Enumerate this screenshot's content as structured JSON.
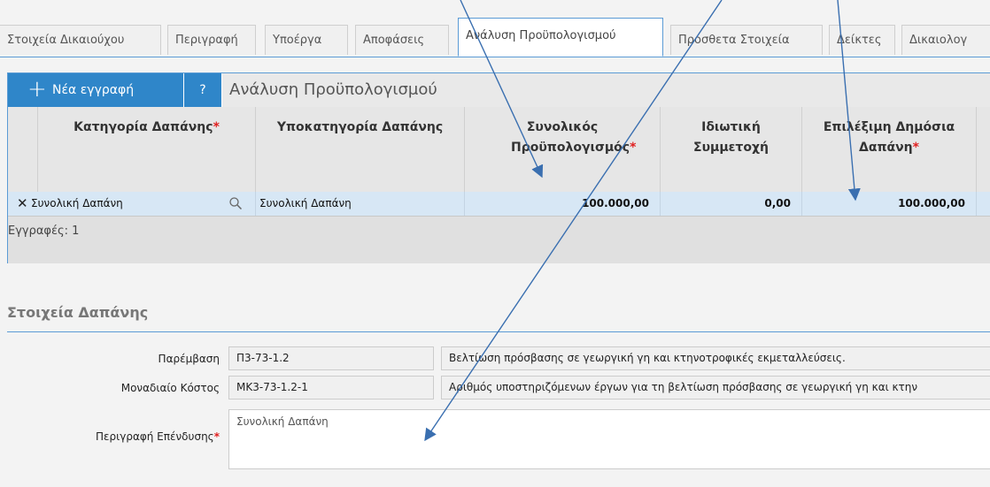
{
  "tabs": [
    {
      "label": "Στοιχεία Δικαιούχου"
    },
    {
      "label": "Περιγραφή"
    },
    {
      "label": "Υποέργα"
    },
    {
      "label": "Αποφάσεις"
    },
    {
      "label": "Ανάλυση Προϋπολογισμού"
    },
    {
      "label": "Πρόσθετα Στοιχεία"
    },
    {
      "label": "Δείκτες"
    },
    {
      "label": "Δικαιολογ"
    }
  ],
  "toolbar": {
    "new_label": "Νέα εγγραφή",
    "help_label": "?",
    "title": "Ανάλυση Προϋπολογισμού"
  },
  "columns": [
    {
      "label": "Κατηγορία Δαπάνης",
      "required": "*"
    },
    {
      "label": "Υποκατηγορία Δαπάνης",
      "required": ""
    },
    {
      "label": "Συνολικός Προϋπολογισμός",
      "required": "*"
    },
    {
      "label": "Ιδιωτική Συμμετοχή",
      "required": ""
    },
    {
      "label": "Επιλέξιμη Δημόσια Δαπάνη",
      "required": "*"
    }
  ],
  "row": {
    "category": "Συνολική Δαπάνη",
    "subcategory": "Συνολική Δαπάνη",
    "total_budget": "100.000,00",
    "private_participation": "0,00",
    "eligible_public": "100.000,00"
  },
  "footer": {
    "records": "Εγγραφές: 1"
  },
  "section": {
    "title": "Στοιχεία Δαπάνης"
  },
  "fields": {
    "intervention_label": "Παρέμβαση",
    "intervention_code": "Π3-73-1.2",
    "intervention_desc": "Βελτίωση πρόσβασης σε γεωργική γη και κτηνοτροφικές εκμεταλλεύσεις.",
    "unit_cost_label": "Μοναδιαίο Κόστος",
    "unit_cost_code": "ΜΚ3-73-1.2-1",
    "unit_cost_desc": "Αριθμός υποστηριζόμενων έργων για τη βελτίωση πρόσβασης σε γεωργική γη και κτην",
    "investment_label": "Περιγραφή Επένδυσης",
    "investment_required": "*",
    "investment_value": "Συνολική Δαπάνη"
  },
  "colors": {
    "accent": "#2f86c9",
    "border_blue": "#5b9bd5",
    "row_selected": "#d7e7f5",
    "required": "#e02020"
  }
}
